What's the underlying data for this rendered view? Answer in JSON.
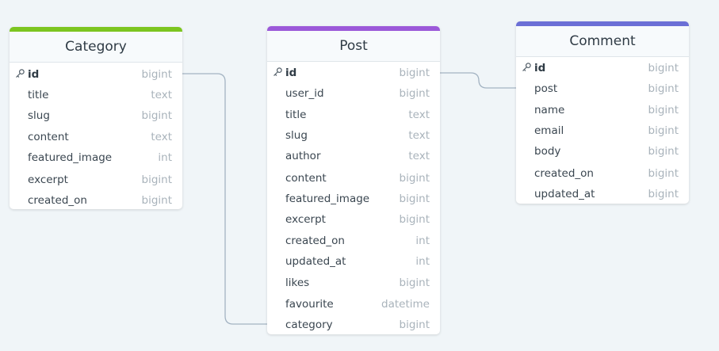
{
  "tables": [
    {
      "name": "Category",
      "accent": "#7cc520",
      "fields": [
        {
          "name": "id",
          "type": "bigint",
          "pk": true
        },
        {
          "name": "title",
          "type": "text"
        },
        {
          "name": "slug",
          "type": "bigint"
        },
        {
          "name": "content",
          "type": "text"
        },
        {
          "name": "featured_image",
          "type": "int"
        },
        {
          "name": "excerpt",
          "type": "bigint"
        },
        {
          "name": "created_on",
          "type": "bigint"
        }
      ]
    },
    {
      "name": "Post",
      "accent": "#9b59d9",
      "fields": [
        {
          "name": "id",
          "type": "bigint",
          "pk": true
        },
        {
          "name": "user_id",
          "type": "bigint"
        },
        {
          "name": "title",
          "type": "text"
        },
        {
          "name": "slug",
          "type": "text"
        },
        {
          "name": "author",
          "type": "text"
        },
        {
          "name": "content",
          "type": "bigint"
        },
        {
          "name": "featured_image",
          "type": "bigint"
        },
        {
          "name": "excerpt",
          "type": "bigint"
        },
        {
          "name": "created_on",
          "type": "int"
        },
        {
          "name": "updated_at",
          "type": "int"
        },
        {
          "name": "likes",
          "type": "bigint"
        },
        {
          "name": "favourite",
          "type": "datetime"
        },
        {
          "name": "category",
          "type": "bigint"
        }
      ]
    },
    {
      "name": "Comment",
      "accent": "#6b6fd6",
      "fields": [
        {
          "name": "id",
          "type": "bigint",
          "pk": true
        },
        {
          "name": "post",
          "type": "bigint"
        },
        {
          "name": "name",
          "type": "bigint"
        },
        {
          "name": "email",
          "type": "bigint"
        },
        {
          "name": "body",
          "type": "bigint"
        },
        {
          "name": "created_on",
          "type": "bigint"
        },
        {
          "name": "updated_at",
          "type": "bigint"
        }
      ]
    }
  ],
  "relations": [
    {
      "from": "Category.id",
      "to": "Post.category"
    },
    {
      "from": "Post.id",
      "to": "Comment.id"
    }
  ]
}
